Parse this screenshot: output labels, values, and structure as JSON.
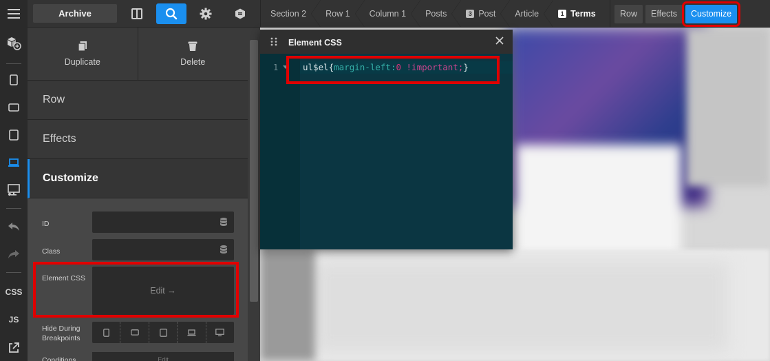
{
  "topbar": {
    "archive_label": "Archive",
    "breadcrumbs": [
      {
        "label": "Section 2",
        "num": ""
      },
      {
        "label": "Row 1",
        "num": ""
      },
      {
        "label": "Column 1",
        "num": ""
      },
      {
        "label": "Posts",
        "num": ""
      },
      {
        "label": "Post",
        "num": "3"
      },
      {
        "label": "Article",
        "num": ""
      },
      {
        "label": "Terms",
        "num": "1"
      }
    ],
    "tabs": [
      "Row",
      "Effects",
      "Customize"
    ],
    "active_tab": "Customize"
  },
  "rail": {
    "css_label": "CSS",
    "js_label": "JS"
  },
  "panel": {
    "actions": {
      "duplicate": "Duplicate",
      "delete": "Delete"
    },
    "sections": {
      "row": "Row",
      "effects": "Effects",
      "customize": "Customize"
    },
    "controls": {
      "id_label": "ID",
      "class_label": "Class",
      "element_css_label": "Element CSS",
      "element_css_button": "Edit →",
      "hide_label_1": "Hide During",
      "hide_label_2": "Breakpoints",
      "conditions_label": "Conditions",
      "conditions_button": "Edit"
    }
  },
  "editor": {
    "title": "Element CSS",
    "line_number": "1",
    "code": {
      "selector": "ul$el{",
      "property": "margin-left:",
      "value": "0",
      "important": " !important;",
      "close": "}"
    }
  },
  "colors": {
    "accent": "#1a8fef",
    "highlight": "#e00000",
    "editor_bg": "#0b3642"
  }
}
